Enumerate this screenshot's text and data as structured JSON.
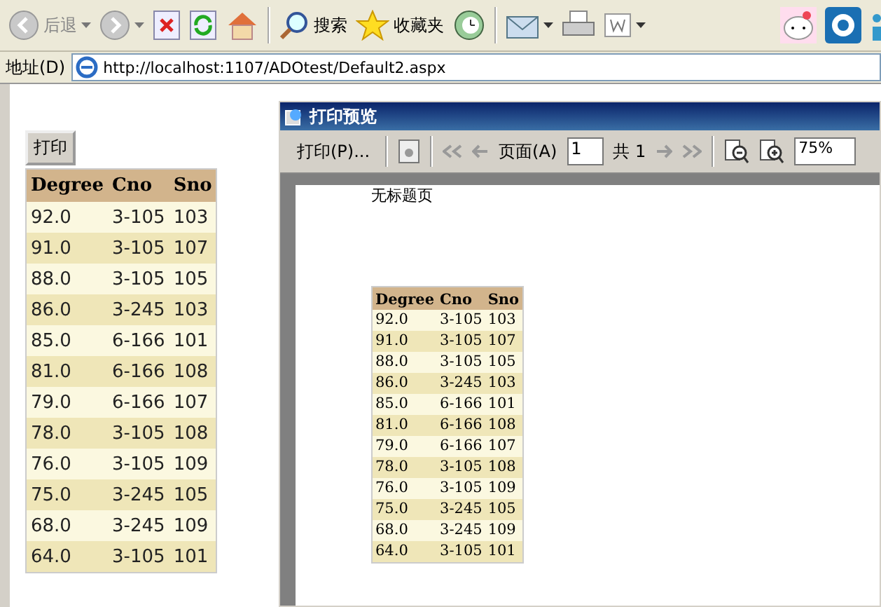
{
  "browser_toolbar": {
    "back_label": "后退",
    "search_label": "搜索",
    "favorites_label": "收藏夹"
  },
  "address_bar": {
    "label": "地址(D)",
    "url": "http://localhost:1107/ADOtest/Default2.aspx"
  },
  "page": {
    "print_button": "打印",
    "table": {
      "columns": [
        "Degree",
        "Cno",
        "Sno"
      ],
      "rows": [
        [
          "92.0",
          "3-105",
          "103"
        ],
        [
          "91.0",
          "3-105",
          "107"
        ],
        [
          "88.0",
          "3-105",
          "105"
        ],
        [
          "86.0",
          "3-245",
          "103"
        ],
        [
          "85.0",
          "6-166",
          "101"
        ],
        [
          "81.0",
          "6-166",
          "108"
        ],
        [
          "79.0",
          "6-166",
          "107"
        ],
        [
          "78.0",
          "3-105",
          "108"
        ],
        [
          "76.0",
          "3-105",
          "109"
        ],
        [
          "75.0",
          "3-245",
          "105"
        ],
        [
          "68.0",
          "3-245",
          "109"
        ],
        [
          "64.0",
          "3-105",
          "101"
        ]
      ]
    }
  },
  "print_preview": {
    "title": "打印预览",
    "print_button": "打印(P)...",
    "page_label": "页面(A)",
    "page_value": "1",
    "total": "共 1",
    "zoom": "75%",
    "page_title": "无标题页",
    "table": {
      "columns": [
        "Degree",
        "Cno",
        "Sno"
      ],
      "rows": [
        [
          "92.0",
          "3-105",
          "103"
        ],
        [
          "91.0",
          "3-105",
          "107"
        ],
        [
          "88.0",
          "3-105",
          "105"
        ],
        [
          "86.0",
          "3-245",
          "103"
        ],
        [
          "85.0",
          "6-166",
          "101"
        ],
        [
          "81.0",
          "6-166",
          "108"
        ],
        [
          "79.0",
          "6-166",
          "107"
        ],
        [
          "78.0",
          "3-105",
          "108"
        ],
        [
          "76.0",
          "3-105",
          "109"
        ],
        [
          "75.0",
          "3-245",
          "105"
        ],
        [
          "68.0",
          "3-245",
          "109"
        ],
        [
          "64.0",
          "3-105",
          "101"
        ]
      ]
    }
  }
}
